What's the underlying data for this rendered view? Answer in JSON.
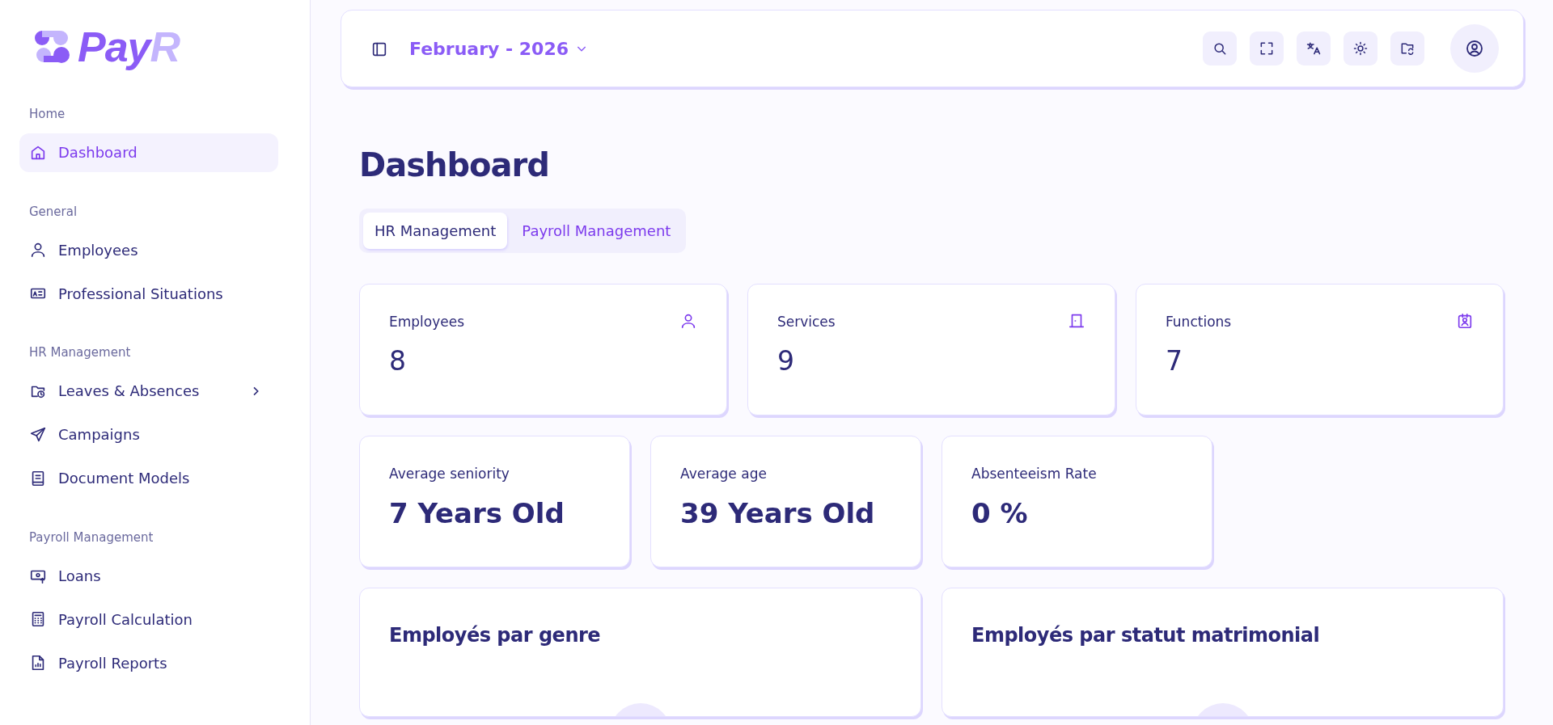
{
  "logo": {
    "text": "Pay",
    "accent": "R"
  },
  "sidebar": {
    "sections": [
      {
        "label": "Home",
        "items": [
          {
            "label": "Dashboard",
            "selected": true
          }
        ]
      },
      {
        "label": "General",
        "items": [
          {
            "label": "Employees",
            "selected": false
          },
          {
            "label": "Professional Situations",
            "selected": false
          }
        ]
      },
      {
        "label": "HR Management",
        "items": [
          {
            "label": "Leaves & Absences",
            "selected": false,
            "expanded": false
          },
          {
            "label": "Campaigns",
            "selected": false
          },
          {
            "label": "Document Models",
            "selected": false
          }
        ]
      },
      {
        "label": "Payroll Management",
        "items": [
          {
            "label": "Loans",
            "selected": false
          },
          {
            "label": "Payroll Calculation",
            "selected": false
          },
          {
            "label": "Payroll Reports",
            "selected": false
          }
        ]
      }
    ]
  },
  "topbar": {
    "period": "February - 2026"
  },
  "page_title": "Dashboard",
  "tabs": [
    {
      "label": "HR Management",
      "selected": true
    },
    {
      "label": "Payroll Management",
      "selected": false
    }
  ],
  "stat_rows": [
    [
      {
        "label": "Employees",
        "value": "8"
      },
      {
        "label": "Services",
        "value": "9"
      },
      {
        "label": "Functions",
        "value": "7"
      }
    ],
    [
      {
        "label": "Average seniority",
        "value": "7 Years Old"
      },
      {
        "label": "Average age",
        "value": "39 Years Old"
      },
      {
        "label": "Absenteeism Rate",
        "value": "0 %"
      }
    ]
  ],
  "chart_cards": [
    {
      "title": "Employés par genre"
    },
    {
      "title": "Employés par statut matrimonial"
    }
  ]
}
